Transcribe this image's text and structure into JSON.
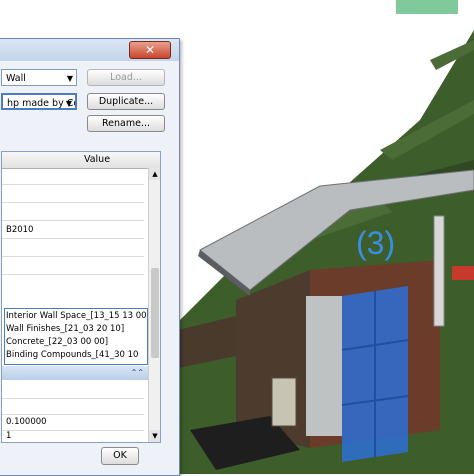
{
  "dialog": {
    "close_glyph": "✕",
    "family_value": "Wall",
    "type_value": "hp made by Contl",
    "load_label": "Load...",
    "duplicate_label": "Duplicate...",
    "rename_label": "Rename...",
    "value_header": "Value",
    "rows": [
      "",
      "",
      "",
      "B2010",
      "",
      "",
      "Interior Wall Space_[13_15 13 00",
      "Wall Finishes_[21_03 20 10]",
      "Concrete_[22_03 00 00]",
      "Binding Compounds_[41_30 10",
      "",
      "",
      "0.100000",
      "1",
      ""
    ],
    "group_toggle": "⌃⌃",
    "apply_label": "OK"
  },
  "viewport": {
    "callout": "(3)",
    "colors": {
      "sky": "#ffffff",
      "terrain": "#3b5a2a",
      "roof": "#b9bdbf",
      "glass": "#2e6fd6",
      "brick": "#6b3c2a",
      "siding": "#4d3b2e"
    }
  }
}
